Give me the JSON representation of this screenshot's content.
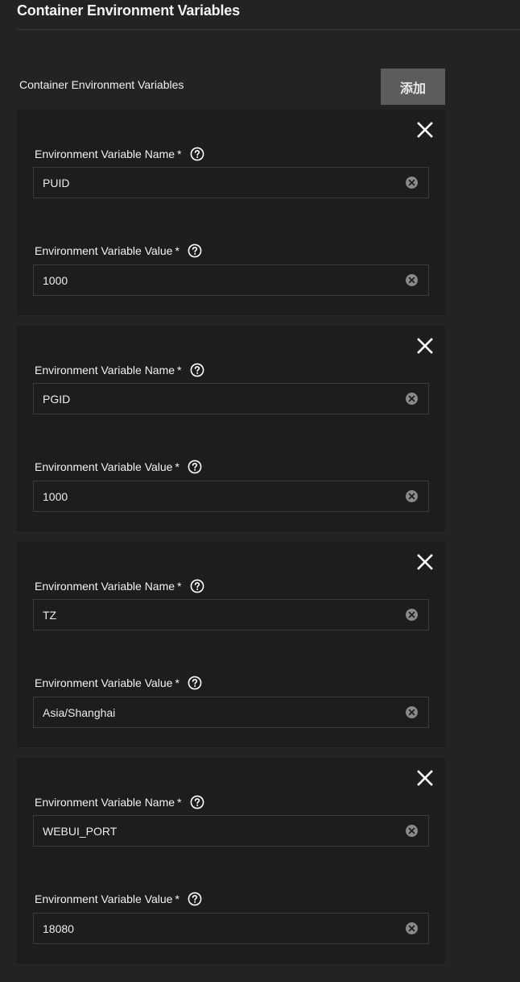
{
  "section": {
    "title": "Container Environment Variables"
  },
  "group": {
    "label": "Container Environment Variables",
    "add_button_label": "添加"
  },
  "field_labels": {
    "name": "Environment Variable Name",
    "value": "Environment Variable Value",
    "required_marker": "*"
  },
  "icons": {
    "remove": "close-icon",
    "help": "help-circle-icon",
    "clear": "clear-circle-icon"
  },
  "env_vars": [
    {
      "name": "PUID",
      "value": "1000"
    },
    {
      "name": "PGID",
      "value": "1000"
    },
    {
      "name": "TZ",
      "value": "Asia/Shanghai"
    },
    {
      "name": "WEBUI_PORT",
      "value": "18080"
    }
  ],
  "colors": {
    "background": "#232323",
    "card": "#1d1d1d",
    "input_border": "#3b3b3b",
    "button": "#5c5c5c",
    "text": "#f2f2f2"
  }
}
